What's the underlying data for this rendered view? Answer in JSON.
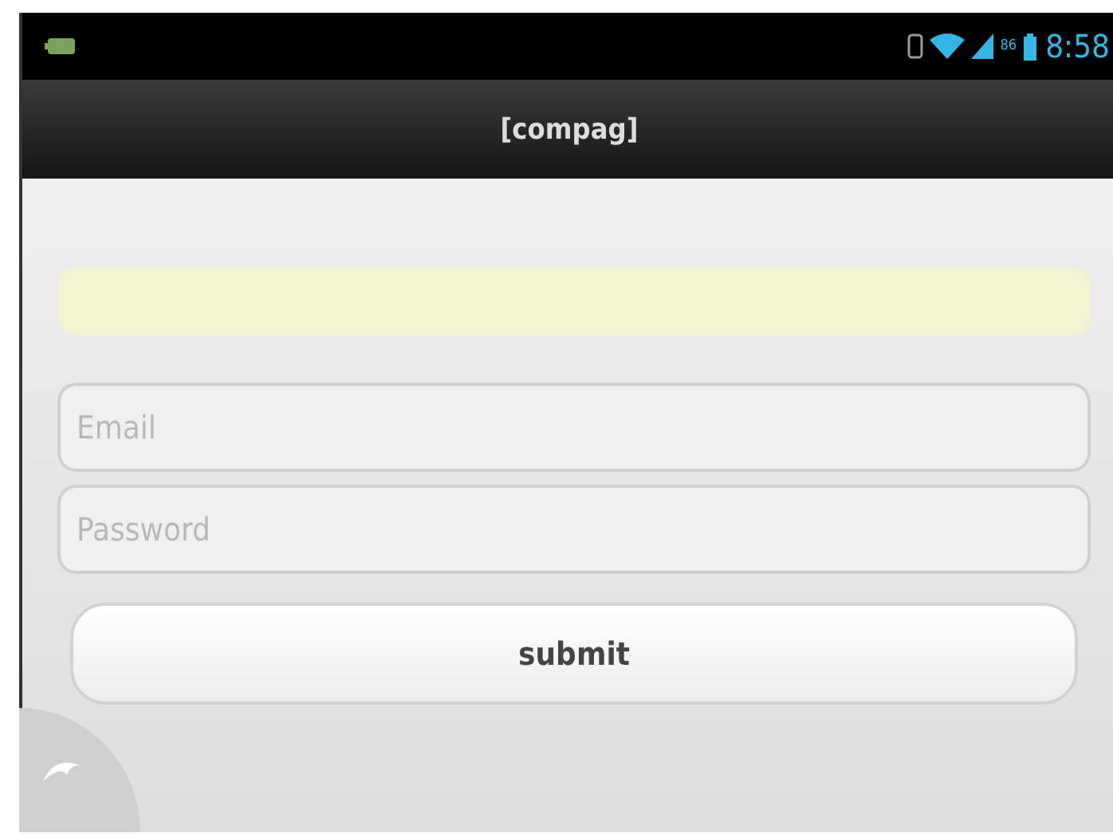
{
  "status_bar": {
    "battery_percent": "86",
    "time": "8:58"
  },
  "title_bar": {
    "title": "[compag]"
  },
  "form": {
    "fields": [
      {
        "placeholder": "Email"
      },
      {
        "placeholder": "Password"
      }
    ],
    "submit": "submit"
  }
}
